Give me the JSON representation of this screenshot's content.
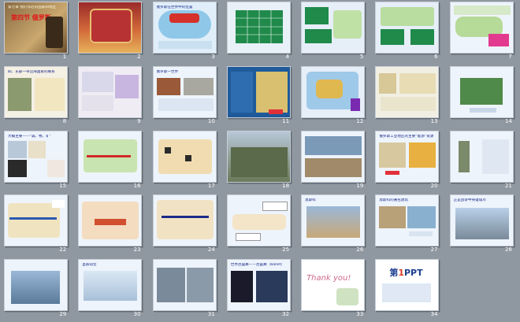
{
  "slides": [
    {
      "number": "1",
      "title": "第七章 我们邻近的国家和地区",
      "subtitle": "第四节 俄罗斯"
    },
    {
      "number": "2"
    },
    {
      "number": "3",
      "title": "俄罗斯在世界中的位置"
    },
    {
      "number": "4"
    },
    {
      "number": "5"
    },
    {
      "number": "6"
    },
    {
      "number": "7"
    },
    {
      "number": "8",
      "title": "四、东部一带沿海国家的联系"
    },
    {
      "number": "9"
    },
    {
      "number": "10",
      "title": "俄罗斯一世界"
    },
    {
      "number": "11"
    },
    {
      "number": "12"
    },
    {
      "number": "13"
    },
    {
      "number": "14"
    },
    {
      "number": "15",
      "title": "大概主要——“森、牧、矿”"
    },
    {
      "number": "16"
    },
    {
      "number": "17"
    },
    {
      "number": "18"
    },
    {
      "number": "19"
    },
    {
      "number": "20",
      "title": "俄罗斯工业地区的主要“能源”资源"
    },
    {
      "number": "21"
    },
    {
      "number": "22"
    },
    {
      "number": "23"
    },
    {
      "number": "24"
    },
    {
      "number": "25"
    },
    {
      "number": "26",
      "title": "莫斯科"
    },
    {
      "number": "27",
      "title": "莫斯科的著名建筑"
    },
    {
      "number": "28",
      "title": "正是战争中英雄城市"
    },
    {
      "number": "29"
    },
    {
      "number": "30",
      "title": "圣彼得堡"
    },
    {
      "number": "31"
    },
    {
      "number": "32",
      "title": "世界芭蕾舞——芭蕾舞（ballet）"
    },
    {
      "number": "33",
      "text": "Thank you!"
    },
    {
      "number": "34",
      "brand_main": "第",
      "brand_num": "1",
      "brand_rest": "PPT"
    }
  ]
}
